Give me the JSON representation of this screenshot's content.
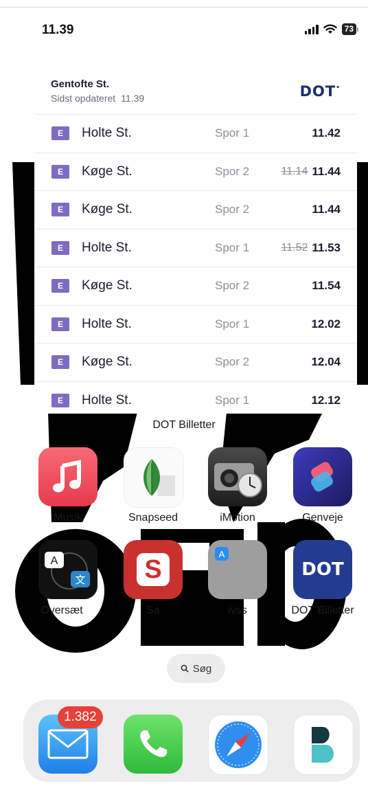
{
  "status_bar": {
    "time": "11.39",
    "battery": "73"
  },
  "widget": {
    "station": "Gentofte St.",
    "updated_label": "Sidst opdateret",
    "updated_time": "11.39",
    "logo": "DOT",
    "rows": [
      {
        "line": "E",
        "destination": "Holte St.",
        "track": "Spor 1",
        "old_time": "",
        "time": "11.42"
      },
      {
        "line": "E",
        "destination": "Køge St.",
        "track": "Spor 2",
        "old_time": "11.14",
        "time": "11.44"
      },
      {
        "line": "E",
        "destination": "Køge St.",
        "track": "Spor 2",
        "old_time": "",
        "time": "11.44"
      },
      {
        "line": "E",
        "destination": "Holte St.",
        "track": "Spor 1",
        "old_time": "11.52",
        "time": "11.53"
      },
      {
        "line": "E",
        "destination": "Køge St.",
        "track": "Spor 2",
        "old_time": "",
        "time": "11.54"
      },
      {
        "line": "E",
        "destination": "Holte St.",
        "track": "Spor 1",
        "old_time": "",
        "time": "12.02"
      },
      {
        "line": "E",
        "destination": "Køge St.",
        "track": "Spor 2",
        "old_time": "",
        "time": "12.04"
      },
      {
        "line": "E",
        "destination": "Holte St.",
        "track": "Spor 1",
        "old_time": "",
        "time": "12.12"
      }
    ],
    "widget_label": "DOT Billetter"
  },
  "apps": {
    "musik": "Musik",
    "snapseed": "Snapseed",
    "imotion": "iMotion",
    "genveje": "Genveje",
    "oversaet": "Oversæt",
    "sa": "Sa",
    "folder": "ivss",
    "dot": "DOT Billetter",
    "dot_icon_text": "DOT",
    "translate_a": "A",
    "translate_wen": "文",
    "s_letter": "S"
  },
  "search": {
    "label": "Søg"
  },
  "dock": {
    "mail_badge": "1.382"
  }
}
